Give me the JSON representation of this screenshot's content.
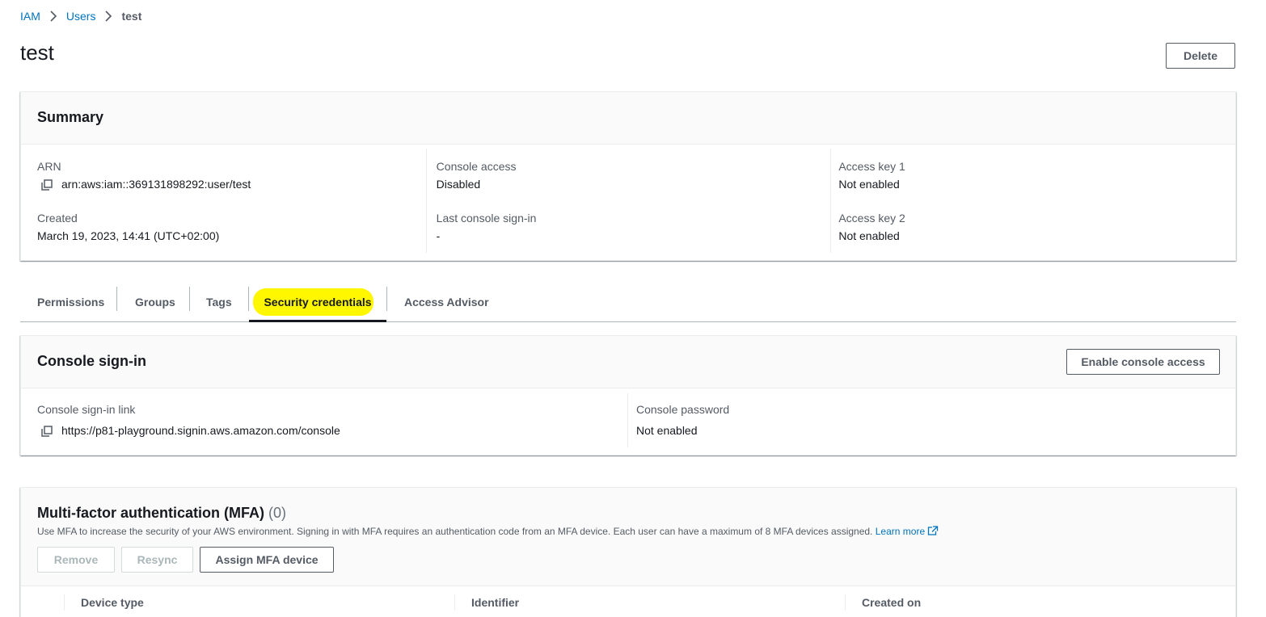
{
  "breadcrumb": {
    "iam": "IAM",
    "users": "Users",
    "current": "test"
  },
  "page": {
    "title": "test",
    "delete_label": "Delete"
  },
  "summary": {
    "title": "Summary",
    "arn_label": "ARN",
    "arn_value": "arn:aws:iam::369131898292:user/test",
    "created_label": "Created",
    "created_value": "March 19, 2023, 14:41 (UTC+02:00)",
    "console_access_label": "Console access",
    "console_access_value": "Disabled",
    "last_signin_label": "Last console sign-in",
    "last_signin_value": "-",
    "key1_label": "Access key 1",
    "key1_value": "Not enabled",
    "key2_label": "Access key 2",
    "key2_value": "Not enabled"
  },
  "tabs": [
    {
      "label": "Permissions"
    },
    {
      "label": "Groups"
    },
    {
      "label": "Tags"
    },
    {
      "label": "Security credentials",
      "active": true
    },
    {
      "label": "Access Advisor"
    }
  ],
  "console_signin": {
    "title": "Console sign-in",
    "enable_label": "Enable console access",
    "link_label": "Console sign-in link",
    "link_value": "https://p81-playground.signin.aws.amazon.com/console",
    "password_label": "Console password",
    "password_value": "Not enabled"
  },
  "mfa": {
    "title": "Multi-factor authentication (MFA)",
    "count": "(0)",
    "description": "Use MFA to increase the security of your AWS environment. Signing in with MFA requires an authentication code from an MFA device. Each user can have a maximum of 8 MFA devices assigned.",
    "learn_more": "Learn more",
    "remove_label": "Remove",
    "resync_label": "Resync",
    "assign_label": "Assign MFA device",
    "columns": [
      "Device type",
      "Identifier",
      "Created on"
    ]
  },
  "colors": {
    "link": "#0073bb",
    "highlight": "#fff700",
    "text": "#16191f",
    "muted": "#545b64"
  }
}
